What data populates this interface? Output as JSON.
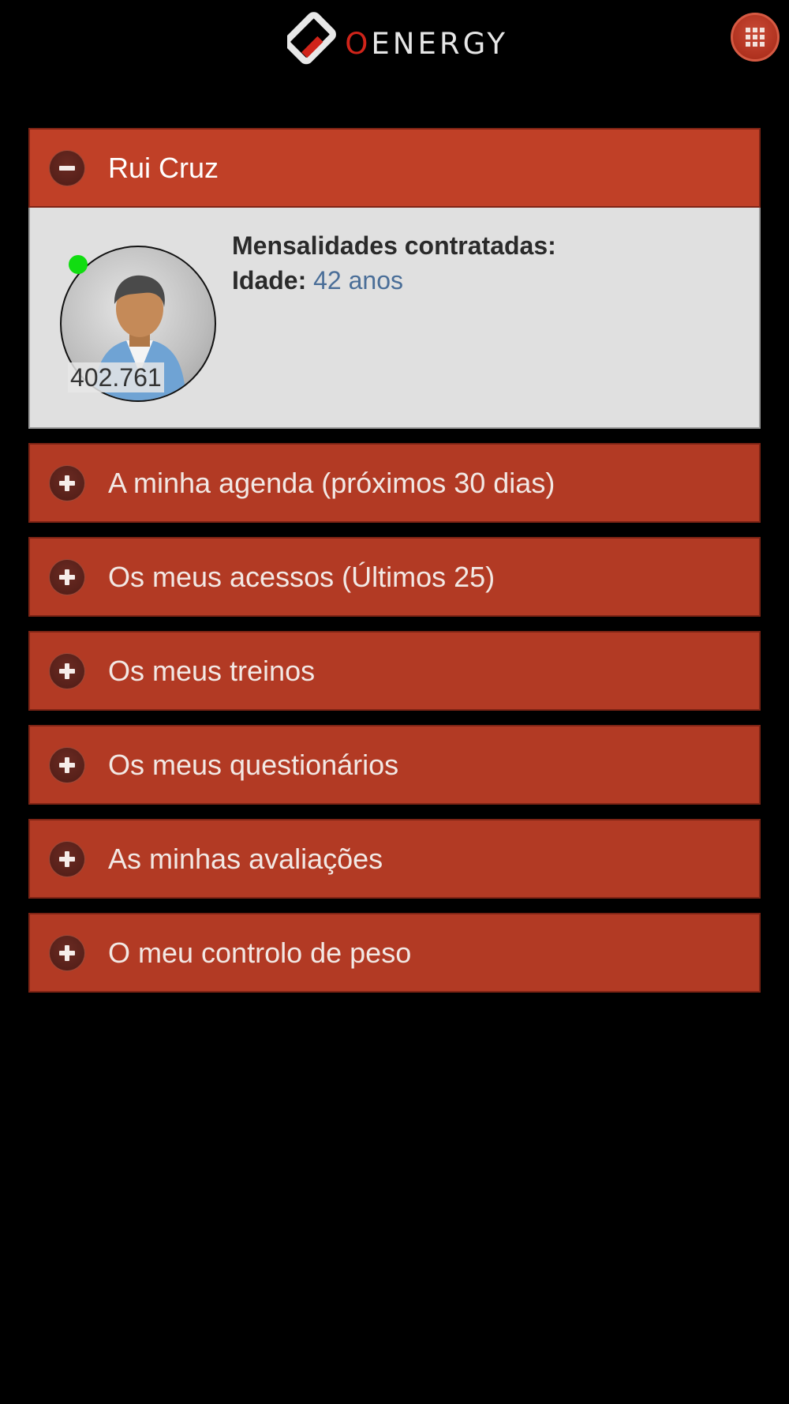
{
  "header": {
    "logo_o": "O",
    "logo_rest": "ENERGY",
    "apps_button_icon": "grid-icon"
  },
  "profile_panel": {
    "title": "Rui Cruz",
    "toggle_icon": "minus-icon",
    "member_number": "402.761",
    "status_color": "#11dd11",
    "contracted_label": "Mensalidades contratadas:",
    "contracted_value": "",
    "age_label": "Idade:",
    "age_value": "42 anos"
  },
  "panels": [
    {
      "title": "A minha agenda (próximos 30 dias)",
      "toggle_icon": "plus-icon"
    },
    {
      "title": "Os meus acessos (Últimos 25)",
      "toggle_icon": "plus-icon"
    },
    {
      "title": "Os meus treinos",
      "toggle_icon": "plus-icon"
    },
    {
      "title": "Os meus questionários",
      "toggle_icon": "plus-icon"
    },
    {
      "title": "As minhas avaliações",
      "toggle_icon": "plus-icon"
    },
    {
      "title": "O meu controlo de peso",
      "toggle_icon": "plus-icon"
    }
  ],
  "colors": {
    "accent": "#b23a24",
    "accent_active": "#c04027",
    "background": "#000000",
    "link_value": "#4a6e98"
  }
}
